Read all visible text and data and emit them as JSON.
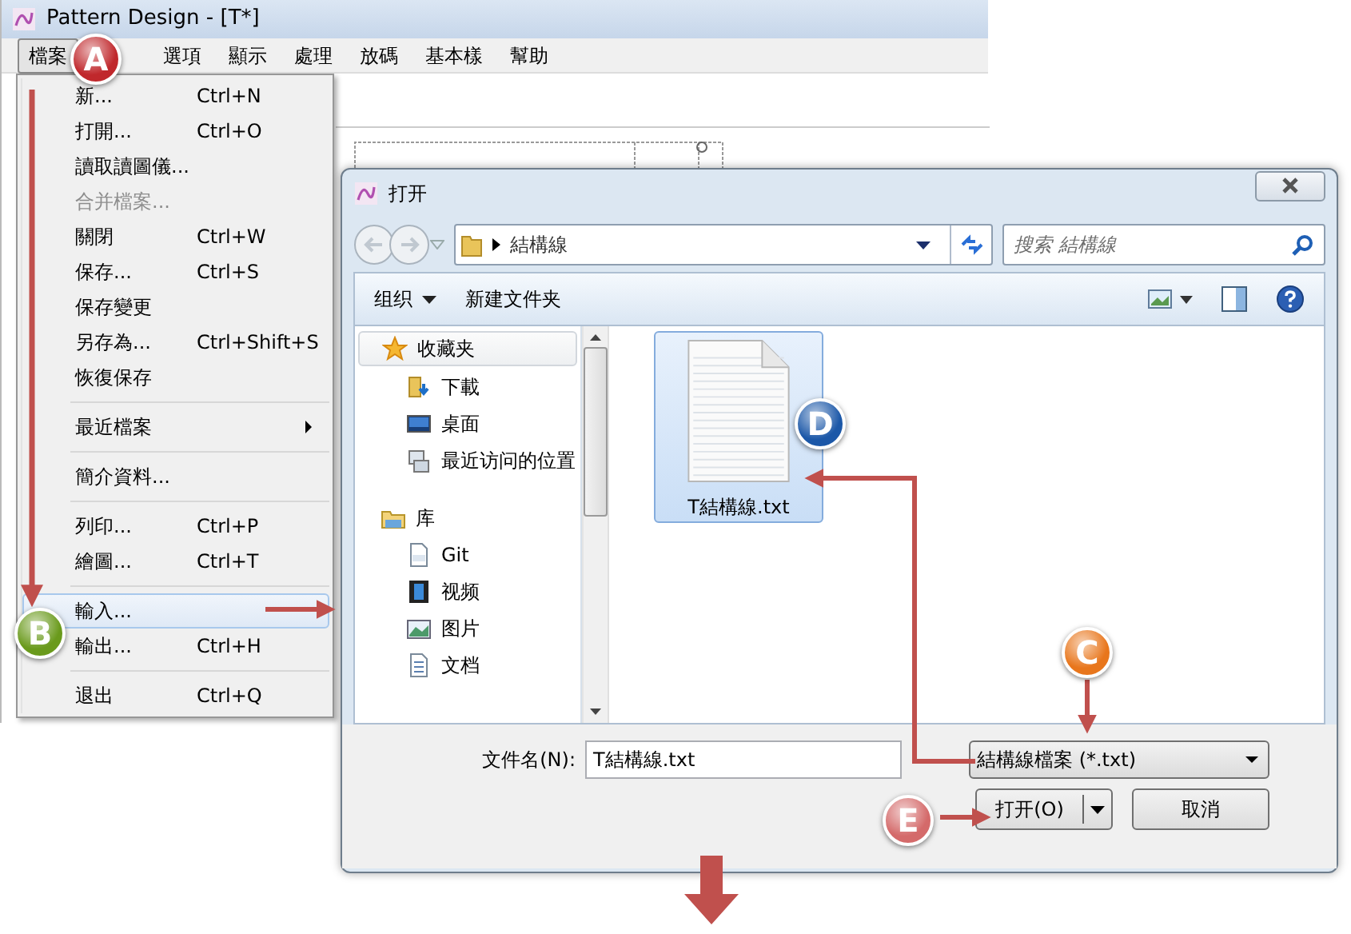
{
  "app": {
    "title": "Pattern Design - [T*]",
    "menus": [
      {
        "label": "檔案",
        "selected": true
      },
      {
        "label": "選項",
        "selected": false
      },
      {
        "label": "顯示",
        "selected": false
      },
      {
        "label": "處理",
        "selected": false
      },
      {
        "label": "放碼",
        "selected": false
      },
      {
        "label": "基本樣",
        "selected": false
      },
      {
        "label": "幫助",
        "selected": false
      }
    ]
  },
  "file_menu": [
    {
      "kind": "item",
      "label": "新...",
      "shortcut": "Ctrl+N",
      "disabled": false,
      "highlighted": false
    },
    {
      "kind": "item",
      "label": "打開...",
      "shortcut": "Ctrl+O",
      "disabled": false,
      "highlighted": false
    },
    {
      "kind": "item",
      "label": "讀取讀圖儀...",
      "disabled": false,
      "highlighted": false
    },
    {
      "kind": "item",
      "label": "合并檔案...",
      "disabled": true,
      "highlighted": false
    },
    {
      "kind": "item",
      "label": "關閉",
      "shortcut": "Ctrl+W",
      "disabled": false,
      "highlighted": false
    },
    {
      "kind": "item",
      "label": "保存...",
      "shortcut": "Ctrl+S",
      "disabled": false,
      "highlighted": false
    },
    {
      "kind": "item",
      "label": "保存變更",
      "disabled": false,
      "highlighted": false
    },
    {
      "kind": "item",
      "label": "另存為...",
      "shortcut": "Ctrl+Shift+S",
      "disabled": false,
      "highlighted": false
    },
    {
      "kind": "item",
      "label": "恢復保存",
      "disabled": false,
      "highlighted": false
    },
    {
      "kind": "separator"
    },
    {
      "kind": "submenu",
      "label": "最近檔案",
      "disabled": false,
      "highlighted": false
    },
    {
      "kind": "separator"
    },
    {
      "kind": "item",
      "label": "簡介資料...",
      "disabled": false,
      "highlighted": false
    },
    {
      "kind": "separator"
    },
    {
      "kind": "item",
      "label": "列印...",
      "shortcut": "Ctrl+P",
      "disabled": false,
      "highlighted": false
    },
    {
      "kind": "item",
      "label": "繪圖...",
      "shortcut": "Ctrl+T",
      "disabled": false,
      "highlighted": false
    },
    {
      "kind": "separator"
    },
    {
      "kind": "item",
      "label": "輸入...",
      "disabled": false,
      "highlighted": true
    },
    {
      "kind": "item",
      "label": "輸出...",
      "shortcut": "Ctrl+H",
      "disabled": false,
      "highlighted": false
    },
    {
      "kind": "separator"
    },
    {
      "kind": "item",
      "label": "退出",
      "shortcut": "Ctrl+Q",
      "disabled": false,
      "highlighted": false
    }
  ],
  "dialog": {
    "title": "打开",
    "address": "結構線",
    "search": {
      "placeholder": "搜索 結構線"
    },
    "toolbar": [
      {
        "label": "组织",
        "dropdown": true
      },
      {
        "label": "新建文件夹",
        "dropdown": false
      }
    ],
    "nav": [
      {
        "kind": "favorites",
        "label": "收藏夹",
        "children": [
          {
            "kind": "download",
            "label": "下載"
          },
          {
            "kind": "desktop",
            "label": "桌面"
          },
          {
            "kind": "recent",
            "label": "最近访问的位置"
          }
        ]
      },
      {
        "kind": "library",
        "label": "库",
        "children": [
          {
            "kind": "git",
            "label": "Git"
          },
          {
            "kind": "video",
            "label": "视频"
          },
          {
            "kind": "pictures",
            "label": "图片"
          },
          {
            "kind": "documents",
            "label": "文档"
          }
        ]
      }
    ],
    "files": [
      {
        "name": "T結構線.txt",
        "selected": true
      }
    ],
    "filename_label": "文件名(N):",
    "filename": "T結構線.txt",
    "filetype": "結構線檔案 (*.txt)",
    "open_button": "打开(O)",
    "cancel_button": "取消"
  },
  "callouts": [
    {
      "letter": "A",
      "color": "#c0282c"
    },
    {
      "letter": "B",
      "color": "#6a9a1c"
    },
    {
      "letter": "C",
      "color": "#e8761c"
    },
    {
      "letter": "D",
      "color": "#1c58a8"
    },
    {
      "letter": "E",
      "color": "#d46a6a"
    }
  ]
}
